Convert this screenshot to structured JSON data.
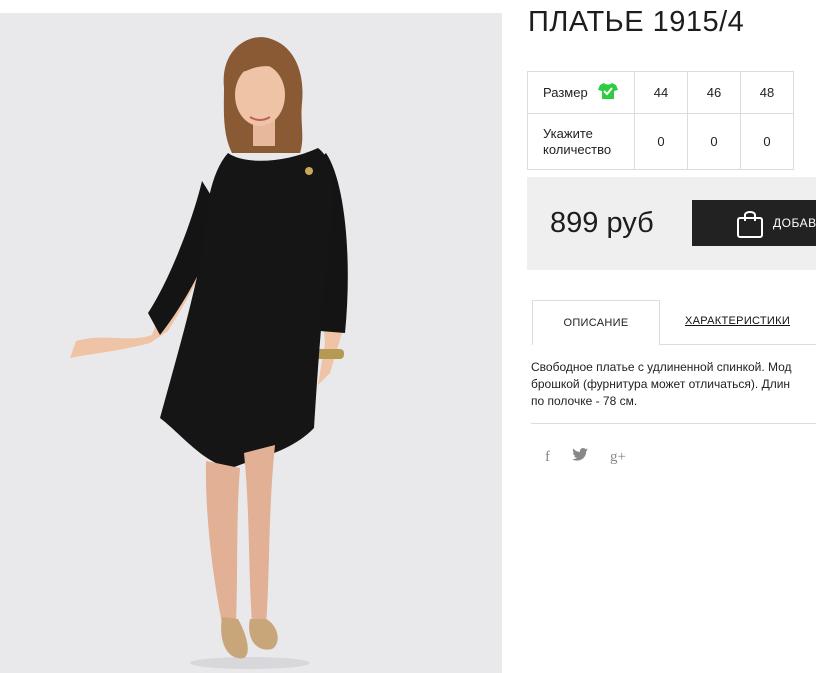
{
  "product": {
    "title": "ПЛАТЬЕ 1915/4",
    "image_alt": "Черное платье, модель"
  },
  "sizes_table": {
    "size_label": "Размер",
    "qty_label": "Укажите количество",
    "qty_label_line1": "Укажите",
    "qty_label_line2": "количество",
    "sizes": [
      "44",
      "46",
      "48"
    ],
    "quantities": [
      "0",
      "0",
      "0"
    ],
    "size_icon": "tshirt-check-icon",
    "size_icon_color": "#2ecc40"
  },
  "purchase": {
    "price": "899 руб",
    "add_button_label": "ДОБАВ",
    "add_button_icon": "shopping-bag-icon"
  },
  "tabs": [
    {
      "label": "ОПИСАНИЕ",
      "active": true
    },
    {
      "label": "ХАРАКТЕРИСТИКИ",
      "active": false
    }
  ],
  "description": {
    "line1": "Свободное платье с удлиненной спинкой. Мод",
    "line2": "брошкой (фурнитура может отличаться). Длин",
    "line3": "по полочке - 78 см."
  },
  "social": [
    {
      "icon": "facebook-icon",
      "glyph": "f"
    },
    {
      "icon": "twitter-icon",
      "glyph": "🐦"
    },
    {
      "icon": "google-plus-icon",
      "glyph": "g+"
    }
  ],
  "colors": {
    "button_bg": "#222222",
    "price_box_bg": "#efefef",
    "photo_bg": "#e9e9ec"
  }
}
